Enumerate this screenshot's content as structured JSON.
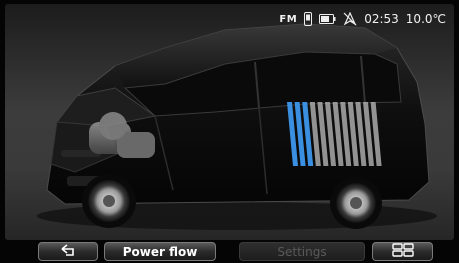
{
  "status_bar": {
    "radio_band": "FM",
    "clock": "02:53",
    "temperature": "10.0℃",
    "icons": [
      "phone-icon",
      "battery-icon",
      "no-navigation-icon"
    ]
  },
  "vehicle": {
    "view": "electric-car-cutaway",
    "battery_highlight_color": "#3b8fe0",
    "battery_cells_total": 12,
    "battery_cells_charged": 3
  },
  "bottom_bar": {
    "back_icon": "back-arrow-icon",
    "power_flow_label": "Power flow",
    "settings_label": "Settings",
    "menu_icon": "grid-menu-icon"
  }
}
